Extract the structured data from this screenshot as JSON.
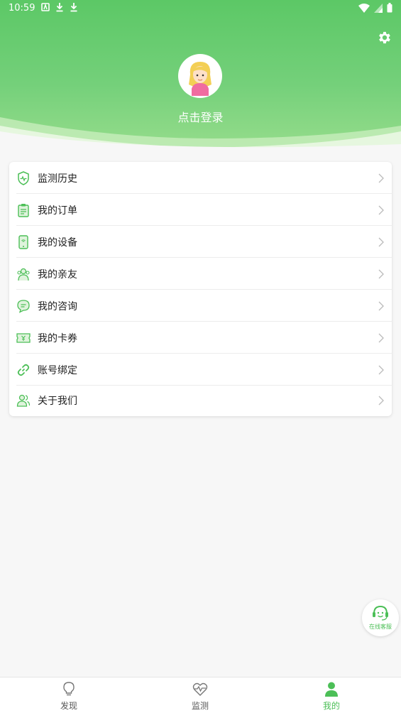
{
  "status_bar": {
    "time": "10:59"
  },
  "header": {
    "login_text": "点击登录"
  },
  "menu": {
    "items": [
      {
        "label": "监测历史",
        "icon": "shield-monitor-icon"
      },
      {
        "label": "我的订单",
        "icon": "clipboard-icon"
      },
      {
        "label": "我的设备",
        "icon": "phone-device-icon"
      },
      {
        "label": "我的亲友",
        "icon": "people-icon"
      },
      {
        "label": "我的咨询",
        "icon": "chat-bubble-icon"
      },
      {
        "label": "我的卡券",
        "icon": "coupon-icon"
      },
      {
        "label": "账号绑定",
        "icon": "link-icon"
      },
      {
        "label": "关于我们",
        "icon": "users-icon"
      }
    ]
  },
  "fab": {
    "label": "在线客服"
  },
  "tabs": [
    {
      "label": "发现",
      "icon": "lightbulb-icon",
      "active": false
    },
    {
      "label": "监测",
      "icon": "heartbeat-icon",
      "active": false
    },
    {
      "label": "我的",
      "icon": "person-icon",
      "active": true
    }
  ],
  "colors": {
    "accent": "#4cbf57",
    "header_top": "#5cc866",
    "header_bottom": "#97dd8c"
  }
}
